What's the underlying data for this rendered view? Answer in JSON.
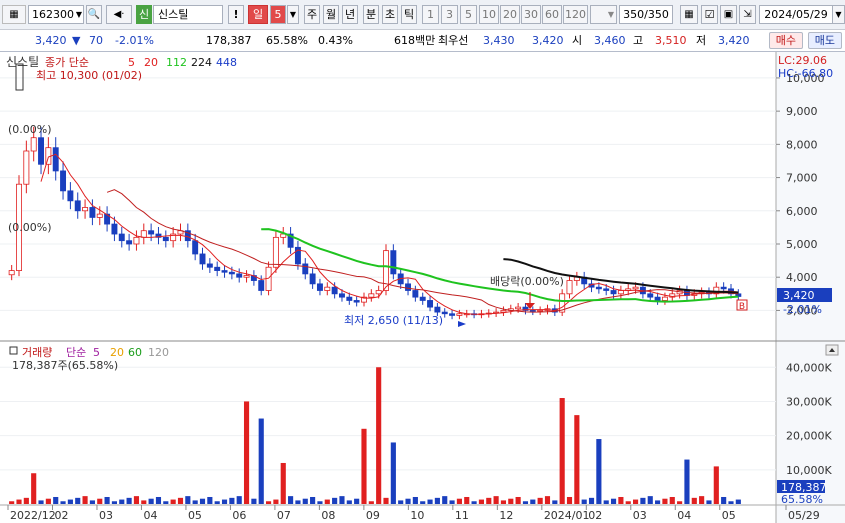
{
  "toolbar": {
    "code": "162300",
    "code_flag": "신",
    "name": "신스틸",
    "info_btn": "!",
    "periods": [
      "일",
      "5",
      "주",
      "월",
      "년",
      "분",
      "초",
      "틱"
    ],
    "active_period": "일",
    "counts": [
      "1",
      "3",
      "5",
      "10",
      "20",
      "30",
      "60",
      "120"
    ],
    "view_count": "350/350",
    "date": "2024/05/29"
  },
  "quote": {
    "price": "3,420",
    "arrow": "▼",
    "change": "70",
    "change_pct": "-2.01%",
    "volume": "178,387",
    "vol_ratio": "65.58%",
    "turnover": "0.43%",
    "amount": "618백만",
    "bid_label": "최우선",
    "bid1": "3,430",
    "bid2": "3,420",
    "open_label": "시",
    "open": "3,460",
    "high_label": "고",
    "high": "3,510",
    "low_label": "저",
    "low": "3,420",
    "buy_label": "매수",
    "sell_label": "매도"
  },
  "chart_data": {
    "type": "candlestick",
    "stock": "신스틸",
    "price_legend": {
      "series_label": "종가 단순",
      "periods": [
        "5",
        "20",
        "112",
        "224",
        "448"
      ],
      "colors": [
        "#e02020",
        "#e02020",
        "#1fc31f",
        "#111111",
        "#1a3cc8"
      ]
    },
    "price_axis": {
      "ticks": [
        3000,
        4000,
        5000,
        6000,
        7000,
        8000,
        9000,
        10000
      ],
      "labels": [
        "3,000",
        "4,000",
        "5,000",
        "6,000",
        "7,000",
        "8,000",
        "9,000",
        "10,000"
      ],
      "min": 2200,
      "max": 10600
    },
    "time_axis": [
      "2022/12",
      "02",
      "03",
      "04",
      "05",
      "06",
      "07",
      "08",
      "09",
      "10",
      "11",
      "12",
      "2024/01",
      "02",
      "03",
      "04",
      "05",
      "05/29"
    ],
    "high_note": "최고 10,300 (01/02)",
    "low_note": "최저 2,650 (11/13)",
    "dividend_note": "배당락(0.00%)",
    "left_notes": [
      "(0.00%)",
      "(0.00%)"
    ],
    "marker": "B",
    "lc": "LC:29.06",
    "hc": "HC:-66.80",
    "current_price": "3,420",
    "current_pct": "-2.01%",
    "closes": [
      4200,
      6800,
      7800,
      8200,
      7400,
      7900,
      7200,
      6600,
      6300,
      6000,
      6100,
      5800,
      5900,
      5600,
      5300,
      5100,
      5000,
      5200,
      5400,
      5300,
      5200,
      5100,
      5300,
      5400,
      5100,
      4700,
      4400,
      4300,
      4200,
      4150,
      4100,
      4000,
      4050,
      3900,
      3600,
      4300,
      5200,
      5300,
      4900,
      4400,
      4100,
      3800,
      3600,
      3700,
      3500,
      3400,
      3300,
      3250,
      3400,
      3500,
      3600,
      4800,
      4100,
      3800,
      3600,
      3400,
      3300,
      3100,
      2950,
      2900,
      2850,
      2900,
      2900,
      2880,
      2900,
      2920,
      2950,
      3000,
      3050,
      3100,
      3000,
      2980,
      3000,
      3050,
      2950,
      3500,
      3900,
      4000,
      3800,
      3700,
      3650,
      3600,
      3500,
      3600,
      3650,
      3700,
      3500,
      3400,
      3300,
      3400,
      3500,
      3600,
      3450,
      3500,
      3550,
      3500,
      3700,
      3650,
      3500,
      3420
    ],
    "volume_legend": {
      "title": "거래량",
      "series_label": "단순",
      "periods": [
        "5",
        "20",
        "60",
        "120"
      ],
      "colors": [
        "#a020a0",
        "#e8a000",
        "#1a9c1a",
        "#999999"
      ]
    },
    "volume_note": "178,387주(65.58%)",
    "volume_axis": {
      "ticks": [
        10000,
        20000,
        30000,
        40000
      ],
      "labels": [
        "10,000K",
        "20,000K",
        "30,000K",
        "40,000K"
      ],
      "max": 43000
    },
    "current_volume": "178,387",
    "current_volume_pct": "65.58%",
    "volume_spikes": [
      {
        "i": 3,
        "v": 9000
      },
      {
        "i": 32,
        "v": 30000
      },
      {
        "i": 34,
        "v": 25000
      },
      {
        "i": 37,
        "v": 12000
      },
      {
        "i": 48,
        "v": 22000
      },
      {
        "i": 50,
        "v": 40000
      },
      {
        "i": 52,
        "v": 18000
      },
      {
        "i": 75,
        "v": 31000
      },
      {
        "i": 77,
        "v": 26000
      },
      {
        "i": 80,
        "v": 19000
      },
      {
        "i": 92,
        "v": 13000
      },
      {
        "i": 96,
        "v": 11000
      }
    ]
  }
}
